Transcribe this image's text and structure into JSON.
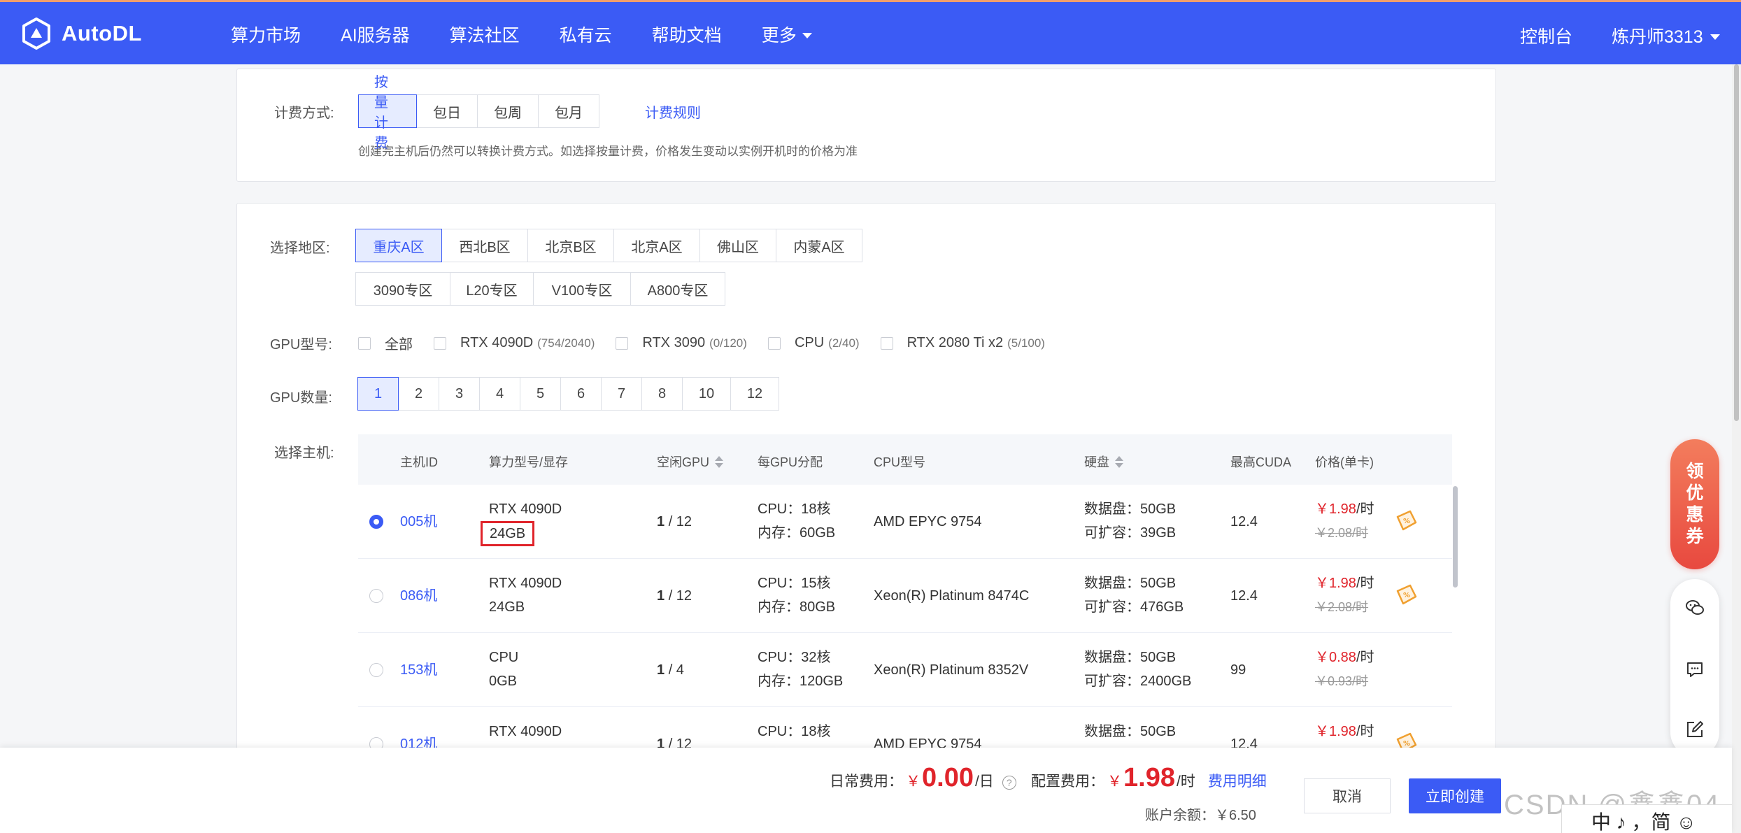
{
  "header": {
    "logo_text": "AutoDL",
    "nav": [
      "算力市场",
      "AI服务器",
      "算法社区",
      "私有云",
      "帮助文档",
      "更多"
    ],
    "console": "控制台",
    "user": "炼丹师3313"
  },
  "billing": {
    "label": "计费方式:",
    "options": [
      "按量计费",
      "包日",
      "包周",
      "包月"
    ],
    "active_index": 0,
    "rules_link": "计费规则",
    "hint": "创建完主机后仍然可以转换计费方式。如选择按量计费，价格发生变动以实例开机时的价格为准"
  },
  "region": {
    "label": "选择地区:",
    "row1": [
      "重庆A区",
      "西北B区",
      "北京B区",
      "北京A区",
      "佛山区",
      "内蒙A区"
    ],
    "row2": [
      "3090专区",
      "L20专区",
      "V100专区",
      "A800专区"
    ],
    "active_index": 0
  },
  "gpu_model": {
    "label": "GPU型号:",
    "options": [
      {
        "name": "全部",
        "count": ""
      },
      {
        "name": "RTX 4090D",
        "count": "(754/2040)"
      },
      {
        "name": "RTX 3090",
        "count": "(0/120)"
      },
      {
        "name": "CPU",
        "count": "(2/40)"
      },
      {
        "name": "RTX 2080 Ti x2",
        "count": "(5/100)"
      }
    ]
  },
  "gpu_count": {
    "label": "GPU数量:",
    "options": [
      "1",
      "2",
      "3",
      "4",
      "5",
      "6",
      "7",
      "8",
      "10",
      "12"
    ],
    "active_index": 0
  },
  "host": {
    "label": "选择主机:",
    "columns": [
      "主机ID",
      "算力型号/显存",
      "空闲GPU",
      "每GPU分配",
      "CPU型号",
      "硬盘",
      "最高CUDA",
      "价格(单卡)"
    ],
    "rows": [
      {
        "id": "005机",
        "model": "RTX 4090D",
        "vram": "24GB",
        "free": "1",
        "total": "/ 12",
        "cpu": "CPU：18核",
        "mem": "内存：60GB",
        "cpu_model": "AMD EPYC 9754",
        "disk": "数据盘：50GB",
        "expand": "可扩容：39GB",
        "cuda": "12.4",
        "price": "￥1.98",
        "price_unit": "/时",
        "old_price": "￥2.08/时",
        "selected": true
      },
      {
        "id": "086机",
        "model": "RTX 4090D",
        "vram": "24GB",
        "free": "1",
        "total": "/ 12",
        "cpu": "CPU：15核",
        "mem": "内存：80GB",
        "cpu_model": "Xeon(R) Platinum 8474C",
        "disk": "数据盘：50GB",
        "expand": "可扩容：476GB",
        "cuda": "12.4",
        "price": "￥1.98",
        "price_unit": "/时",
        "old_price": "￥2.08/时",
        "selected": false
      },
      {
        "id": "153机",
        "model": "CPU",
        "vram": "0GB",
        "free": "1",
        "total": "/ 4",
        "cpu": "CPU：32核",
        "mem": "内存：120GB",
        "cpu_model": "Xeon(R) Platinum 8352V",
        "disk": "数据盘：50GB",
        "expand": "可扩容：2400GB",
        "cuda": "99",
        "price": "￥0.88",
        "price_unit": "/时",
        "old_price": "￥0.93/时",
        "selected": false
      },
      {
        "id": "012机",
        "model": "RTX 4090D",
        "vram": "",
        "free": "1",
        "total": "/ 12",
        "cpu": "CPU：18核",
        "mem": "",
        "cpu_model": "AMD EPYC 9754",
        "disk": "数据盘：50GB",
        "expand": "",
        "cuda": "12.4",
        "price": "￥1.98",
        "price_unit": "/时",
        "old_price": "",
        "selected": false
      }
    ]
  },
  "side": {
    "promo": [
      "领",
      "优",
      "惠",
      "券"
    ]
  },
  "footer": {
    "daily_label": "日常费用：",
    "daily_yen": "￥",
    "daily_value": "0.00",
    "daily_unit": "/日",
    "help": "?",
    "config_label": "配置费用：",
    "config_yen": "￥",
    "config_value": "1.98",
    "config_unit": "/时",
    "detail_link": "费用明细",
    "balance": "账户余额：￥6.50",
    "cancel": "取消",
    "create": "立即创建"
  },
  "overlay": {
    "watermark": "CSDN @鑫鑫04",
    "ime": "中 ♪ ，简 ☺"
  },
  "colors": {
    "primary": "#3b5bf5",
    "price": "#e0242b",
    "highlight": "#e0242b"
  }
}
